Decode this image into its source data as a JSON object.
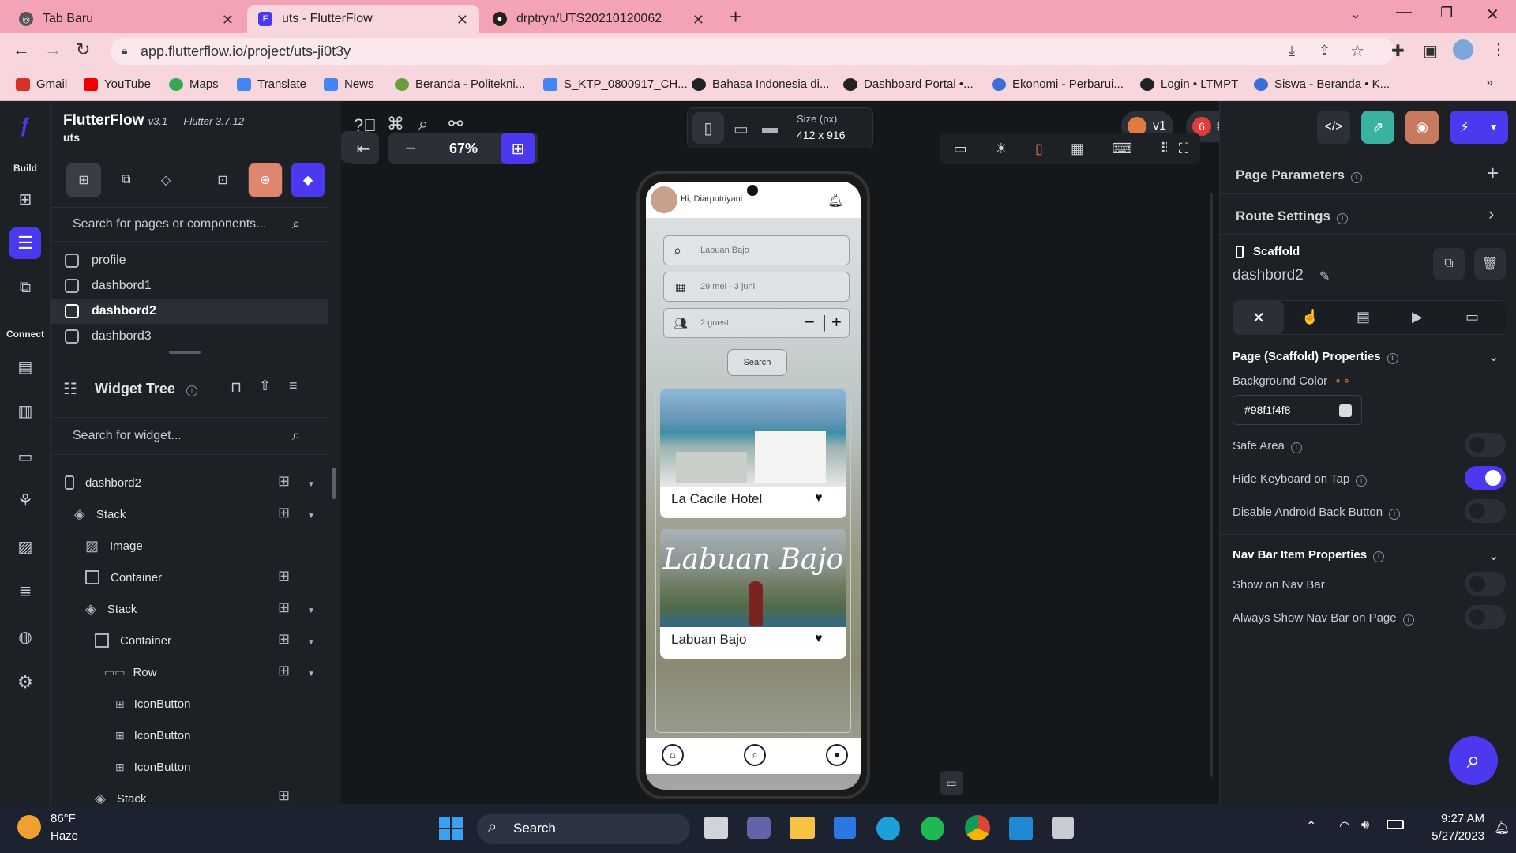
{
  "browser": {
    "tabs": [
      {
        "title": "Tab Baru"
      },
      {
        "title": "uts - FlutterFlow"
      },
      {
        "title": "drptryn/UTS20210120062"
      }
    ],
    "url": "app.flutterflow.io/project/uts-ji0t3y",
    "bookmarks": [
      "Gmail",
      "YouTube",
      "Maps",
      "Translate",
      "News",
      "Beranda - Politekni...",
      "S_KTP_0800917_CH...",
      "Bahasa Indonesia di...",
      "Dashboard Portal •...",
      "Ekonomi - Perbarui...",
      "Login • LTMPT",
      "Siswa - Beranda • K..."
    ]
  },
  "app": {
    "name": "FlutterFlow",
    "version": "v3.1 — Flutter 3.7.12",
    "project": "uts",
    "rail": {
      "build_label": "Build",
      "connect_label": "Connect"
    },
    "pages_search_placeholder": "Search for pages or components...",
    "pages": [
      "profile",
      "dashbord1",
      "dashbord2",
      "dashbord3"
    ],
    "widget_tree_title": "Widget Tree",
    "widget_search_placeholder": "Search for widget...",
    "widgets": [
      "dashbord2",
      "Stack",
      "Image",
      "Container",
      "Stack",
      "Container",
      "Row",
      "IconButton",
      "IconButton",
      "IconButton",
      "Stack"
    ]
  },
  "canvas": {
    "zoom": "67%",
    "size_label": "Size (px)",
    "size_value": "412 x 916",
    "version_badge": "v1",
    "error_count": "6"
  },
  "phone": {
    "greeting": "Hi, Diarputriyani",
    "search_value": "Labuan Bajo",
    "date_value": "29 mei - 3 juni",
    "guest_value": "2 guest",
    "search_button": "Search",
    "cards": [
      {
        "title": "La Cacile Hotel"
      },
      {
        "title": "Labuan Bajo",
        "overlay": "Labuan Bajo"
      }
    ]
  },
  "rightpanel": {
    "page_params": "Page Parameters",
    "route_settings": "Route Settings",
    "scaffold_label": "Scaffold",
    "scaffold_name": "dashbord2",
    "props_title": "Page (Scaffold) Properties",
    "bg_color_label": "Background Color",
    "bg_color_value": "#98f1f4f8",
    "safe_area": "Safe Area",
    "hide_keyboard": "Hide Keyboard on Tap",
    "disable_back": "Disable Android Back Button",
    "nav_props_title": "Nav Bar Item Properties",
    "show_nav": "Show on Nav Bar",
    "always_nav": "Always Show Nav Bar on Page",
    "toggles": {
      "safe_area": false,
      "hide_keyboard": true,
      "disable_back": false,
      "show_nav": false,
      "always_nav": false
    }
  },
  "taskbar": {
    "temp": "86°F",
    "weather": "Haze",
    "search": "Search",
    "time": "9:27 AM",
    "date": "5/27/2023"
  },
  "colors": {
    "accent": "#4b39ef",
    "tabbar": "#f4a3b4",
    "toolbar": "#f8d6dd"
  }
}
